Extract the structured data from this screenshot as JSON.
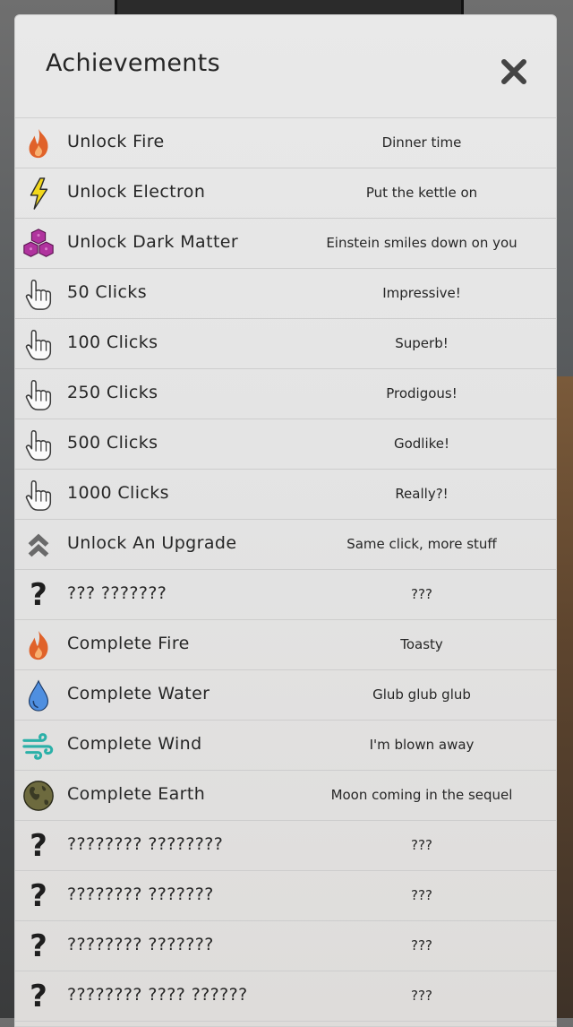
{
  "dialog": {
    "title": "Achievements"
  },
  "achievements": [
    {
      "icon": "fire-icon",
      "name": "Unlock Fire",
      "description": "Dinner time"
    },
    {
      "icon": "lightning-icon",
      "name": "Unlock Electron",
      "description": "Put the kettle on"
    },
    {
      "icon": "cubes-icon",
      "name": "Unlock Dark Matter",
      "description": "Einstein smiles down on you"
    },
    {
      "icon": "pointer-hand-icon",
      "name": "50 Clicks",
      "description": "Impressive!"
    },
    {
      "icon": "pointer-hand-icon",
      "name": "100 Clicks",
      "description": "Superb!"
    },
    {
      "icon": "pointer-hand-icon",
      "name": "250 Clicks",
      "description": "Prodigous!"
    },
    {
      "icon": "pointer-hand-icon",
      "name": "500 Clicks",
      "description": "Godlike!"
    },
    {
      "icon": "pointer-hand-icon",
      "name": "1000 Clicks",
      "description": "Really?!"
    },
    {
      "icon": "double-chevron-up-icon",
      "name": "Unlock An Upgrade",
      "description": "Same click, more stuff"
    },
    {
      "icon": "question-mark-icon",
      "name": "??? ???????",
      "description": "???"
    },
    {
      "icon": "fire-icon",
      "name": "Complete Fire",
      "description": "Toasty"
    },
    {
      "icon": "water-drop-icon",
      "name": "Complete Water",
      "description": "Glub glub glub"
    },
    {
      "icon": "wind-icon",
      "name": "Complete Wind",
      "description": "I'm blown away"
    },
    {
      "icon": "earth-icon",
      "name": "Complete Earth",
      "description": "Moon coming in the sequel"
    },
    {
      "icon": "question-mark-icon",
      "name": "???????? ????????",
      "description": "???"
    },
    {
      "icon": "question-mark-icon",
      "name": "???????? ???????",
      "description": "???"
    },
    {
      "icon": "question-mark-icon",
      "name": "???????? ???????",
      "description": "???"
    },
    {
      "icon": "question-mark-icon",
      "name": "???????? ???? ??????",
      "description": "???"
    }
  ],
  "colors": {
    "fire": "#e0622a",
    "lightning": "#f2d81c",
    "dark_matter": "#b0339e",
    "water": "#4f8fe0",
    "wind": "#2bb0a8",
    "earth": "#6d6a3e"
  }
}
